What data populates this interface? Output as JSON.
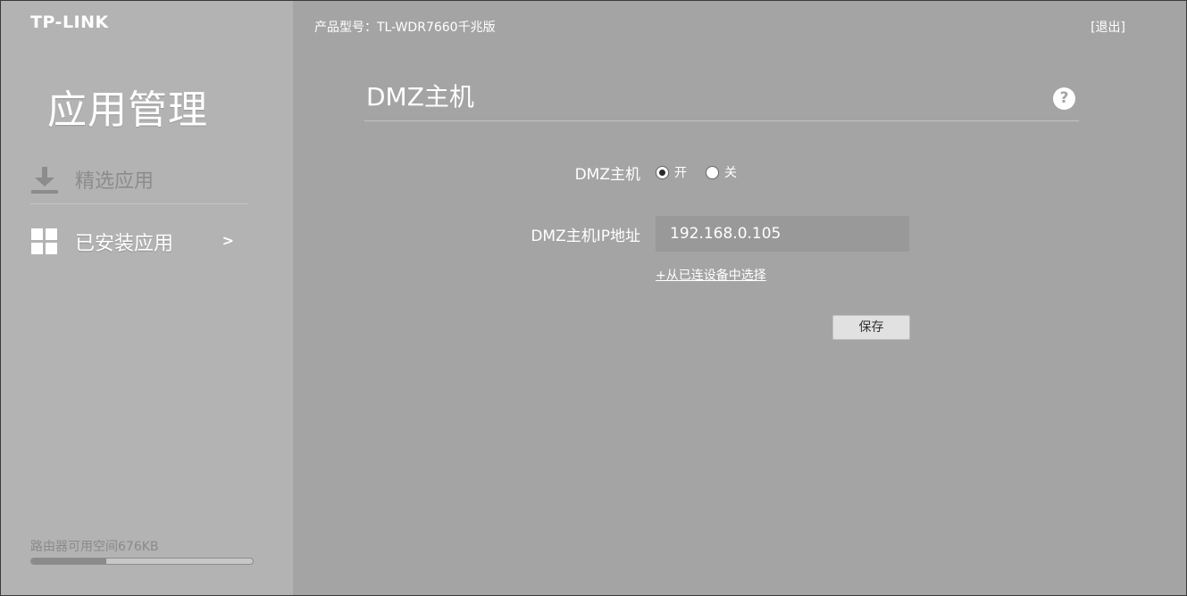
{
  "brand": {
    "logo_text": "TP-LINK"
  },
  "sidebar": {
    "title": "应用管理",
    "items": [
      {
        "label": "精选应用",
        "icon": "download-icon",
        "active": false
      },
      {
        "label": "已安装应用",
        "icon": "grid-icon",
        "active": true,
        "arrow": ">"
      }
    ],
    "storage": {
      "label": "路由器可用空间676KB",
      "used_fraction": 0.34
    }
  },
  "header": {
    "model": "产品型号：TL-WDR7660千兆版",
    "logout": "[退出]"
  },
  "page": {
    "title": "DMZ主机",
    "help_icon": "question-icon",
    "help_glyph": "?"
  },
  "form": {
    "dmz_label": "DMZ主机",
    "radio_on_label": "开",
    "radio_off_label": "关",
    "selected": "on",
    "ip_label": "DMZ主机IP地址",
    "ip_value": "192.168.0.105",
    "pick_device_link": "+从已连设备中选择",
    "save_label": "保存"
  },
  "colors": {
    "main_bg": "#a4a4a4",
    "sidebar_bg": "#b3b3b3",
    "text": "#ffffff"
  }
}
